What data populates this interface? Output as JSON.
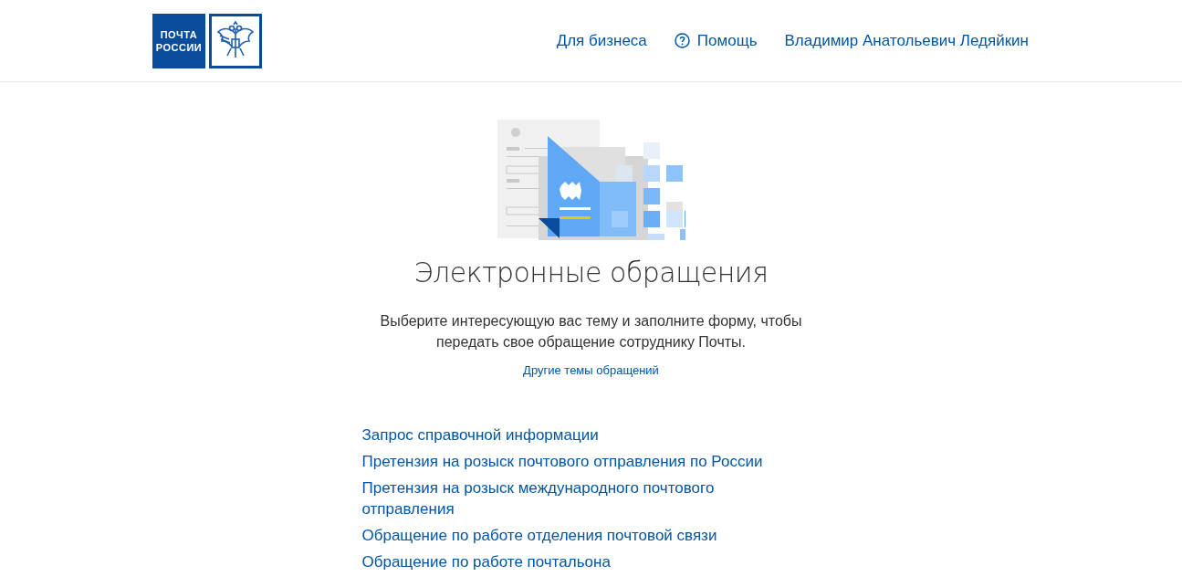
{
  "header": {
    "logo_text": [
      "ПОЧТА",
      "РОССИИ"
    ],
    "nav": [
      {
        "label": "Для бизнеса",
        "kind": "link"
      },
      {
        "label": "Помощь",
        "kind": "help"
      },
      {
        "label": "Владимир Анатольевич Ледяйкин",
        "kind": "link"
      }
    ]
  },
  "main": {
    "title": "Электронные обращения",
    "description": "Выберите интересующую вас тему и заполните форму, чтобы передать свое обращение сотруднику Почты.",
    "other_topics_link": "Другие темы обращений",
    "topics": [
      "Запрос справочной информации",
      "Претензия на розыск почтового отправления по России",
      "Претензия на розыск международного почтового отправления",
      "Обращение по работе отделения почтовой связи",
      "Обращение по работе почтальона"
    ]
  }
}
